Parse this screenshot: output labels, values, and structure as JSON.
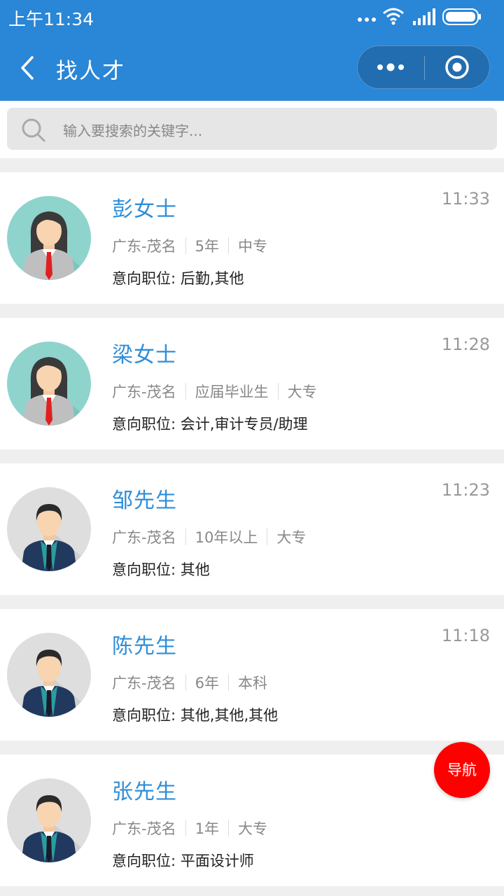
{
  "status_bar": {
    "time": "上午11:34"
  },
  "nav": {
    "title": "找人才"
  },
  "search": {
    "placeholder": "输入要搜索的关键字..."
  },
  "candidates": [
    {
      "name": "彭女士",
      "time": "11:33",
      "location": "广东-茂名",
      "experience": "5年",
      "education": "中专",
      "intent_label": "意向职位:",
      "intent": "后勤,其他",
      "gender": "female"
    },
    {
      "name": "梁女士",
      "time": "11:28",
      "location": "广东-茂名",
      "experience": "应届毕业生",
      "education": "大专",
      "intent_label": "意向职位:",
      "intent": "会计,审计专员/助理",
      "gender": "female"
    },
    {
      "name": "邹先生",
      "time": "11:23",
      "location": "广东-茂名",
      "experience": "10年以上",
      "education": "大专",
      "intent_label": "意向职位:",
      "intent": "其他",
      "gender": "male"
    },
    {
      "name": "陈先生",
      "time": "11:18",
      "location": "广东-茂名",
      "experience": "6年",
      "education": "本科",
      "intent_label": "意向职位:",
      "intent": "其他,其他,其他",
      "gender": "male"
    },
    {
      "name": "张先生",
      "time": "",
      "location": "广东-茂名",
      "experience": "1年",
      "education": "大专",
      "intent_label": "意向职位:",
      "intent": "平面设计师",
      "gender": "male"
    }
  ],
  "fab": {
    "label": "导航"
  },
  "colors": {
    "header": "#2a86d6",
    "name": "#2f8ed8",
    "fab": "#ff0000"
  }
}
